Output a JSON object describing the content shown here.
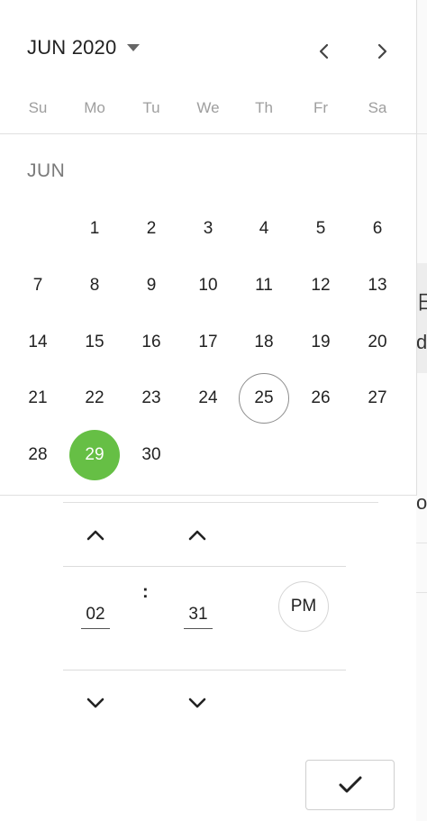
{
  "header": {
    "month_label": "JUN 2020"
  },
  "weekdays": [
    "Su",
    "Mo",
    "Tu",
    "We",
    "Th",
    "Fr",
    "Sa"
  ],
  "calendar": {
    "month_heading": "JUN",
    "days": [
      "1",
      "2",
      "3",
      "4",
      "5",
      "6",
      "7",
      "8",
      "9",
      "10",
      "11",
      "12",
      "13",
      "14",
      "15",
      "16",
      "17",
      "18",
      "19",
      "20",
      "21",
      "22",
      "23",
      "24",
      "25",
      "26",
      "27",
      "28",
      "29",
      "30"
    ],
    "today": "25",
    "selected": "29"
  },
  "time": {
    "hour": "02",
    "minute": "31",
    "separator": ":",
    "meridiem": "PM"
  },
  "background_peek": {
    "glyph_1": "日",
    "glyph_2": "de",
    "glyph_3": "os"
  },
  "colors": {
    "accent": "#66bf45",
    "muted_text": "#9e9e9e",
    "divider": "#e0e0e0"
  },
  "icons": {
    "month_dropdown": "caret-down-icon",
    "prev": "chevron-left-icon",
    "next": "chevron-right-icon",
    "increment": "chevron-up-icon",
    "decrement": "chevron-down-icon",
    "confirm": "checkmark-icon"
  }
}
